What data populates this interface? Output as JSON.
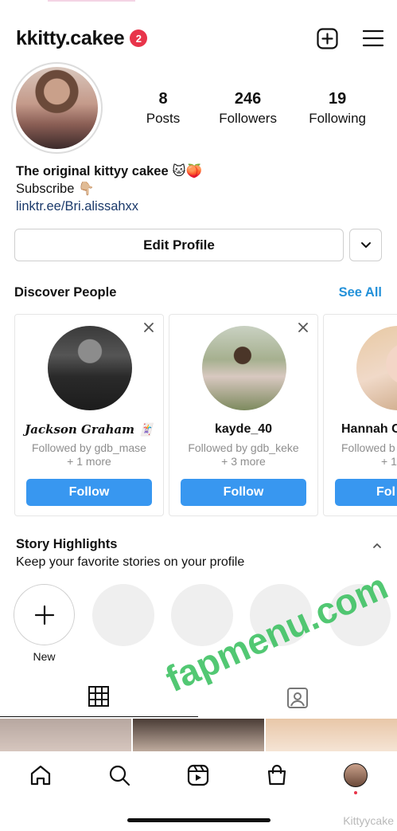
{
  "header": {
    "username": "kkitty.cakee",
    "notification_count": "2"
  },
  "profile": {
    "stats": [
      {
        "number": "8",
        "label": "Posts"
      },
      {
        "number": "246",
        "label": "Followers"
      },
      {
        "number": "19",
        "label": "Following"
      }
    ],
    "bio_line1": "The original kittyy cakee 🐱🍑",
    "bio_line2": "Subscribe 👇🏼",
    "bio_link": "linktr.ee/Bri.alissahxx",
    "edit_button": "Edit Profile"
  },
  "discover": {
    "title": "Discover People",
    "see_all": "See All",
    "cards": [
      {
        "name": "Jackson Graham 🃏",
        "line1": "Followed by gdb_mase",
        "line2": "+ 1 more",
        "follow": "Follow"
      },
      {
        "name": "kayde_40",
        "line1": "Followed by gdb_keke",
        "line2": "+ 3 more",
        "follow": "Follow"
      },
      {
        "name": "Hannah C",
        "line1": "Followed b",
        "line2": "+ 1 r",
        "follow": "Fol"
      }
    ]
  },
  "highlights": {
    "title": "Story Highlights",
    "subtitle": "Keep your favorite stories on your profile",
    "new_label": "New"
  },
  "watermark": "fapmenu.com",
  "watermark_small": "Kittyycake",
  "colors": {
    "accent": "#3897f0",
    "link": "#2391d9",
    "badge": "#e8344a"
  }
}
